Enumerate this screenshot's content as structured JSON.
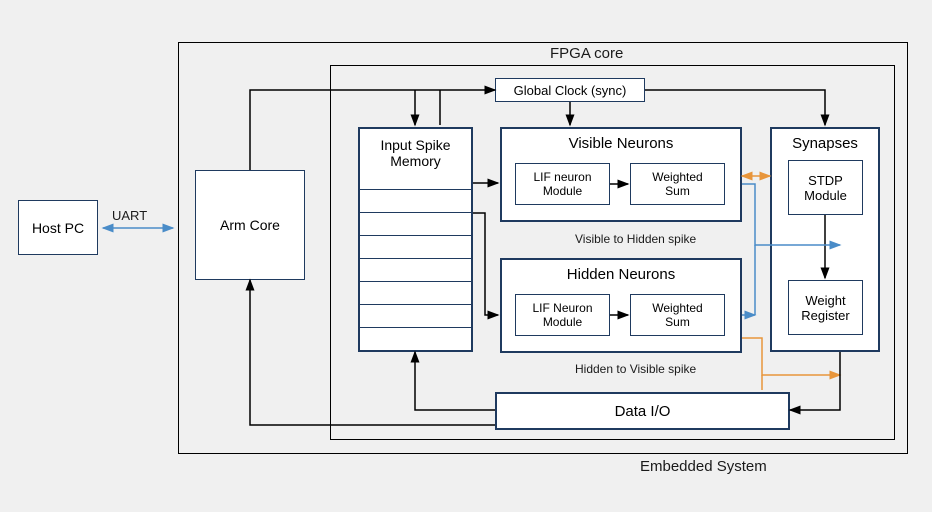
{
  "outer": {
    "embedded_label": "Embedded System",
    "fpga_label": "FPGA core"
  },
  "host_pc": "Host PC",
  "uart": "UART",
  "arm_core": "Arm Core",
  "global_clock": "Global Clock (sync)",
  "input_spike_memory": "Input Spike\nMemory",
  "visible_neurons": {
    "title": "Visible Neurons",
    "lif": "LIF neuron\nModule",
    "wsum": "Weighted\nSum"
  },
  "hidden_neurons": {
    "title": "Hidden Neurons",
    "lif": "LIF Neuron\nModule",
    "wsum": "Weighted\nSum"
  },
  "synapses": {
    "title": "Synapses",
    "stdp": "STDP\nModule",
    "weight_reg": "Weight\nRegister"
  },
  "data_io": "Data I/O",
  "spike_labels": {
    "visible_to_hidden": "Visible to Hidden spike",
    "hidden_to_visible": "Hidden to Visible spike"
  }
}
